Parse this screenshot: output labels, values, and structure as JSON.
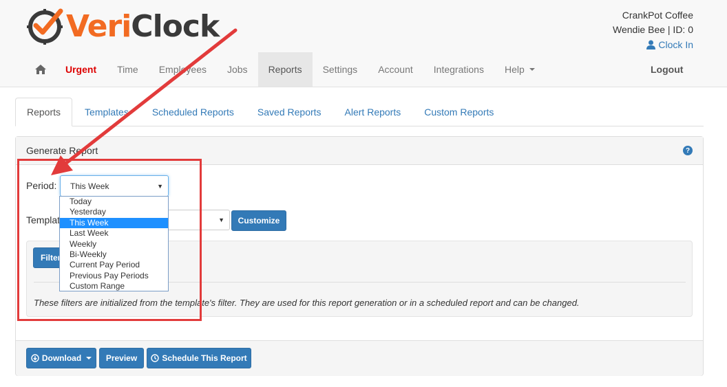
{
  "brand": {
    "name_part1": "Veri",
    "name_part2": "Clock"
  },
  "account": {
    "company": "CrankPot Coffee",
    "user_line": "Wendie Bee | ID: 0",
    "clock_in_label": "Clock In"
  },
  "nav": {
    "items": [
      {
        "label": "Urgent"
      },
      {
        "label": "Time"
      },
      {
        "label": "Employees"
      },
      {
        "label": "Jobs"
      },
      {
        "label": "Reports"
      },
      {
        "label": "Settings"
      },
      {
        "label": "Account"
      },
      {
        "label": "Integrations"
      },
      {
        "label": "Help"
      }
    ],
    "logout_label": "Logout",
    "active": "Reports"
  },
  "tabs": [
    {
      "label": "Reports"
    },
    {
      "label": "Templates"
    },
    {
      "label": "Scheduled Reports"
    },
    {
      "label": "Saved Reports"
    },
    {
      "label": "Alert Reports"
    },
    {
      "label": "Custom Reports"
    }
  ],
  "panel": {
    "title": "Generate Report",
    "period_label": "Period:",
    "period_value": "This Week",
    "template_label": "Templat",
    "customize_label": "Customize",
    "filter_label": "Filter",
    "note": "These filters are initialized from the template's filter. They are used for this report generation or in a scheduled report and can be changed."
  },
  "period_options": [
    {
      "label": "Today"
    },
    {
      "label": "Yesterday"
    },
    {
      "label": "This Week"
    },
    {
      "label": "Last Week"
    },
    {
      "label": "Weekly"
    },
    {
      "label": "Bi-Weekly"
    },
    {
      "label": "Current Pay Period"
    },
    {
      "label": "Previous Pay Periods"
    },
    {
      "label": "Custom Range"
    }
  ],
  "selected_option": "This Week",
  "footer": {
    "download_label": "Download",
    "preview_label": "Preview",
    "schedule_label": "Schedule This Report"
  },
  "colors": {
    "brand_orange": "#f26b22",
    "link_blue": "#337ab7",
    "button_blue": "#337ab7",
    "urgent_red": "#dd0000",
    "annotation_red": "#e23b3b",
    "selection_blue": "#1e90ff"
  },
  "icons": {
    "home": "home-icon",
    "user": "user-icon",
    "help": "question-circle-icon",
    "download": "download-circle-icon",
    "schedule": "clock-icon"
  }
}
